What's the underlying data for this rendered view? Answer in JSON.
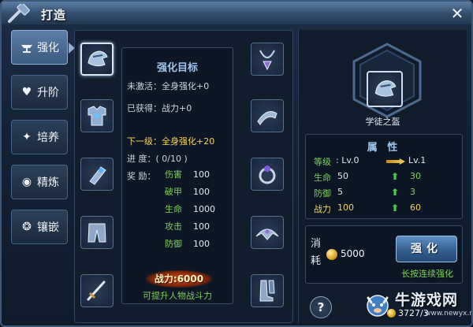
{
  "window": {
    "title": "打造"
  },
  "tabs": [
    {
      "label": "强化",
      "icon": "anvil-icon",
      "active": true
    },
    {
      "label": "升阶",
      "icon": "heart-icon",
      "active": false
    },
    {
      "label": "培养",
      "icon": "sparkle-icon",
      "active": false
    },
    {
      "label": "精炼",
      "icon": "ring-icon",
      "active": false
    },
    {
      "label": "镶嵌",
      "icon": "gem-icon",
      "active": false
    }
  ],
  "equipment_left": [
    "helmet-icon",
    "armor-icon",
    "bracer-icon",
    "pants-icon",
    "sword-icon"
  ],
  "equipment_right": [
    "necklace-icon",
    "belt-icon",
    "ring-icon",
    "shoulder-icon",
    "boots-icon"
  ],
  "target": {
    "title": "强化目标",
    "inactive_label": "未激活：",
    "inactive_value": "全身强化+0",
    "obtained_label": "已获得：",
    "obtained_value": "战力+0",
    "next_label": "下一级：",
    "next_value": "全身强化+20",
    "progress_label": "进 度：",
    "progress_value": "( 0/10 )",
    "reward_label": "奖 励：",
    "rewards": [
      {
        "name": "伤害",
        "value": "100"
      },
      {
        "name": "破甲",
        "value": "100"
      },
      {
        "name": "生命",
        "value": "1000"
      },
      {
        "name": "攻击",
        "value": "100"
      },
      {
        "name": "防御",
        "value": "100"
      }
    ],
    "power_badge": "战力:6000",
    "power_hint": "可提升人物战斗力"
  },
  "selected_item": {
    "name": "学徒之盔"
  },
  "attributes": {
    "title": "属 性",
    "level_label": "等级",
    "level_current": ": Lv.0",
    "level_next": "Lv.1",
    "rows": [
      {
        "name": "生命",
        "current": "50",
        "next": "30"
      },
      {
        "name": "防御",
        "current": "5",
        "next": "3"
      },
      {
        "name": "战力",
        "current": "100",
        "next": "60"
      }
    ]
  },
  "cost": {
    "label": "消耗",
    "value": "5000",
    "button": "强化",
    "hint": "长按连续强化"
  },
  "help": {
    "label": "?"
  },
  "watermark": {
    "text": "牛游戏网",
    "url": "www.newyx.net",
    "gold": "3727/3"
  },
  "colors": {
    "accent": "#9ec6ee",
    "green": "#7fd05a",
    "gold": "#f5d45a",
    "frame": "#3e5878"
  }
}
